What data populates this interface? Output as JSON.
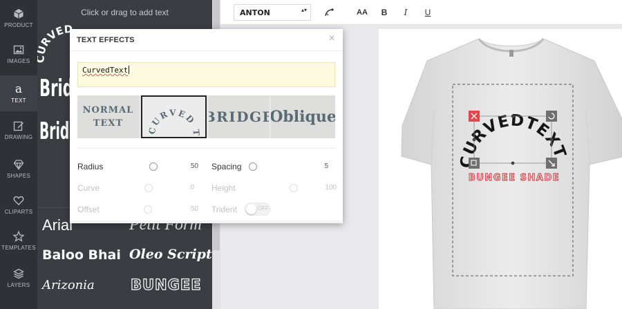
{
  "rail": {
    "items": [
      {
        "label": "PRODUCT",
        "icon": "cube-icon"
      },
      {
        "label": "IMAGES",
        "icon": "image-icon"
      },
      {
        "label": "TEXT",
        "icon": "text-icon",
        "glyph": "a",
        "active": true
      },
      {
        "label": "DRAWING",
        "icon": "pencil-icon"
      },
      {
        "label": "SHAPES",
        "icon": "diamond-icon"
      },
      {
        "label": "CLIPARTS",
        "icon": "heart-icon"
      },
      {
        "label": "TEMPLATES",
        "icon": "star-icon"
      },
      {
        "label": "LAYERS",
        "icon": "layers-icon"
      }
    ]
  },
  "panel": {
    "hint": "Click or drag to add text",
    "samples": {
      "curved": "CURVED",
      "bridge": "Brid",
      "bridge2": "Brid",
      "arial": "Arial",
      "petit": "Petit Form",
      "baloo": "Baloo Bhai",
      "oleo": "Oleo Script S",
      "arizonia": "Arizonia",
      "bungee": "BUNGEE"
    }
  },
  "toolbar": {
    "font_value": "ANTON",
    "font_arrows": "▴▾",
    "buttons": {
      "font_size": "AA",
      "bold": "B",
      "italic": "I",
      "underline": "U"
    }
  },
  "modal": {
    "title": "TEXT EFFECTS",
    "close": "×",
    "input_value": "CurvedText",
    "effects": {
      "normal_line1": "NORMAL",
      "normal_line2": "TEXT",
      "curved": "CURVED TEXT",
      "bridge": "BRIDGE",
      "oblique": "Oblique"
    },
    "rows": {
      "radius_label": "Radius",
      "radius_value": "50",
      "spacing_label": "Spacing",
      "spacing_value": "5",
      "curve_label": "Curve",
      "curve_value": "0",
      "height_label": "Height",
      "height_value": "100",
      "offset_label": "Offset",
      "offset_value": "50",
      "trident_label": "Trident",
      "trident_toggle": "OFF"
    }
  },
  "design": {
    "curved_text": "CURVEDTEXT",
    "bottom_text": "BUNGEE SHADE"
  },
  "colors": {
    "rail_bg": "#2f3136",
    "panel_bg": "#3b3d43",
    "input_bg": "#fdfbdf",
    "effect_text": "#596b74",
    "delete_handle": "#e0474c",
    "design_red": "#c9323a"
  }
}
